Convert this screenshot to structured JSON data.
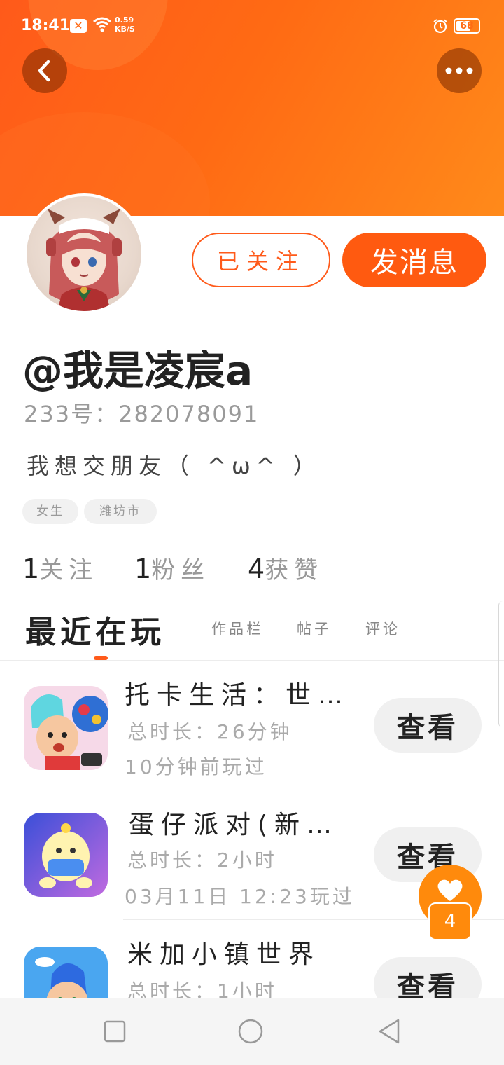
{
  "status_bar": {
    "time": "18:41",
    "net_speed_value": "0.59",
    "net_speed_unit": "KB/S",
    "battery": "68",
    "battery_level": 0.68
  },
  "header": {
    "back_icon": "chevron-left-icon",
    "more_icon": "more-dots-icon",
    "accent_color": "#ff5a1a"
  },
  "profile": {
    "follow_label": "已关注",
    "message_label": "发消息",
    "nickname": "@我是凌宸a",
    "uid": "233号：282078091",
    "bio": "我想交朋友（ ^ω^ ）",
    "tags": [
      "女生",
      "潍坊市"
    ]
  },
  "stats": [
    {
      "num": "1",
      "label": "关注"
    },
    {
      "num": "1",
      "label": "粉丝"
    },
    {
      "num": "4",
      "label": "获赞"
    }
  ],
  "tabs": {
    "active": "最近在玩",
    "others": [
      "作品栏",
      "帖子",
      "评论"
    ]
  },
  "games": [
    {
      "name": "托卡生活：世界",
      "duration": "总时长：26分钟",
      "last_played": "10分钟前玩过",
      "button": "查看"
    },
    {
      "name": "蛋仔派对(新…",
      "duration": "总时长：2小时",
      "last_played": "03月11日 12:23玩过",
      "button": "查看"
    },
    {
      "name": "米加小镇世界",
      "duration": "总时长：1小时",
      "last_played": "",
      "button": "查看"
    }
  ],
  "floating": {
    "count": "4"
  }
}
